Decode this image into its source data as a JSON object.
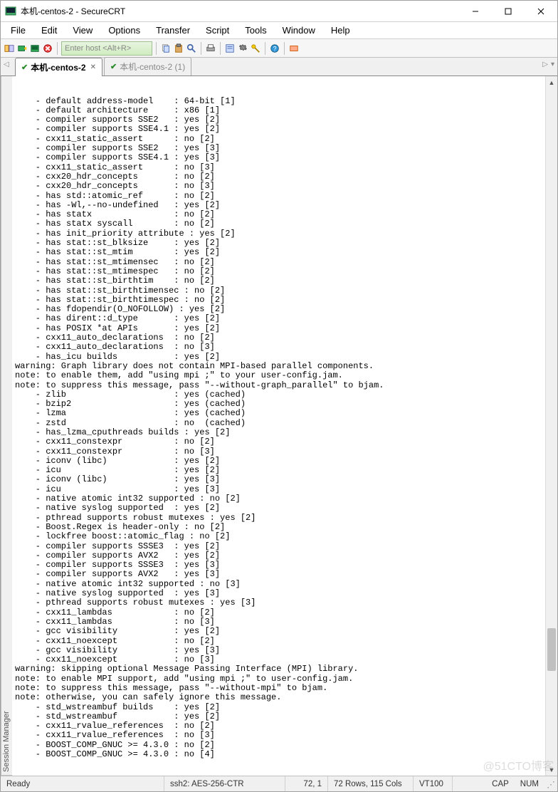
{
  "window": {
    "title": "本机-centos-2 - SecureCRT"
  },
  "menu": [
    "File",
    "Edit",
    "View",
    "Options",
    "Transfer",
    "Script",
    "Tools",
    "Window",
    "Help"
  ],
  "toolbar": {
    "host_placeholder": "Enter host <Alt+R>"
  },
  "tabs": [
    {
      "label": "本机-centos-2",
      "active": true
    },
    {
      "label": "本机-centos-2 (1)",
      "active": false
    }
  ],
  "session_manager_label": "Session Manager",
  "terminal_lines": [
    "    - default address-model    : 64-bit [1]",
    "    - default architecture     : x86 [1]",
    "    - compiler supports SSE2   : yes [2]",
    "    - compiler supports SSE4.1 : yes [2]",
    "    - cxx11_static_assert      : no [2]",
    "    - compiler supports SSE2   : yes [3]",
    "    - compiler supports SSE4.1 : yes [3]",
    "    - cxx11_static_assert      : no [3]",
    "    - cxx20_hdr_concepts       : no [2]",
    "    - cxx20_hdr_concepts       : no [3]",
    "    - has std::atomic_ref      : no [2]",
    "    - has -Wl,--no-undefined   : yes [2]",
    "    - has statx                : no [2]",
    "    - has statx syscall        : no [2]",
    "    - has init_priority attribute : yes [2]",
    "    - has stat::st_blksize     : yes [2]",
    "    - has stat::st_mtim        : yes [2]",
    "    - has stat::st_mtimensec   : no [2]",
    "    - has stat::st_mtimespec   : no [2]",
    "    - has stat::st_birthtim    : no [2]",
    "    - has stat::st_birthtimensec : no [2]",
    "    - has stat::st_birthtimespec : no [2]",
    "    - has fdopendir(O_NOFOLLOW) : yes [2]",
    "    - has dirent::d_type       : yes [2]",
    "    - has POSIX *at APIs       : yes [2]",
    "    - cxx11_auto_declarations  : no [2]",
    "    - cxx11_auto_declarations  : no [3]",
    "    - has_icu builds           : yes [2]",
    "warning: Graph library does not contain MPI-based parallel components.",
    "note: to enable them, add \"using mpi ;\" to your user-config.jam.",
    "note: to suppress this message, pass \"--without-graph_parallel\" to bjam.",
    "    - zlib                     : yes (cached)",
    "    - bzip2                    : yes (cached)",
    "    - lzma                     : yes (cached)",
    "    - zstd                     : no  (cached)",
    "    - has_lzma_cputhreads builds : yes [2]",
    "    - cxx11_constexpr          : no [2]",
    "    - cxx11_constexpr          : no [3]",
    "    - iconv (libc)             : yes [2]",
    "    - icu                      : yes [2]",
    "    - iconv (libc)             : yes [3]",
    "    - icu                      : yes [3]",
    "    - native atomic int32 supported : no [2]",
    "    - native syslog supported  : yes [2]",
    "    - pthread supports robust mutexes : yes [2]",
    "    - Boost.Regex is header-only : no [2]",
    "    - lockfree boost::atomic_flag : no [2]",
    "    - compiler supports SSSE3  : yes [2]",
    "    - compiler supports AVX2   : yes [2]",
    "    - compiler supports SSSE3  : yes [3]",
    "    - compiler supports AVX2   : yes [3]",
    "    - native atomic int32 supported : no [3]",
    "    - native syslog supported  : yes [3]",
    "    - pthread supports robust mutexes : yes [3]",
    "    - cxx11_lambdas            : no [2]",
    "    - cxx11_lambdas            : no [3]",
    "    - gcc visibility           : yes [2]",
    "    - cxx11_noexcept           : no [2]",
    "    - gcc visibility           : yes [3]",
    "    - cxx11_noexcept           : no [3]",
    "warning: skipping optional Message Passing Interface (MPI) library.",
    "note: to enable MPI support, add \"using mpi ;\" to user-config.jam.",
    "note: to suppress this message, pass \"--without-mpi\" to bjam.",
    "note: otherwise, you can safely ignore this message.",
    "    - std_wstreambuf builds    : yes [2]",
    "    - std_wstreambuf           : yes [2]",
    "    - cxx11_rvalue_references  : no [2]",
    "    - cxx11_rvalue_references  : no [3]",
    "    - BOOST_COMP_GNUC >= 4.3.0 : no [2]",
    "    - BOOST_COMP_GNUC >= 4.3.0 : no [4]"
  ],
  "status": {
    "ready": "Ready",
    "cipher": "ssh2: AES-256-CTR",
    "cursor": "72,   1",
    "size": "72 Rows, 115 Cols",
    "term": "VT100",
    "caps": "CAP",
    "num": "NUM"
  },
  "watermark": "@51CTO博客"
}
